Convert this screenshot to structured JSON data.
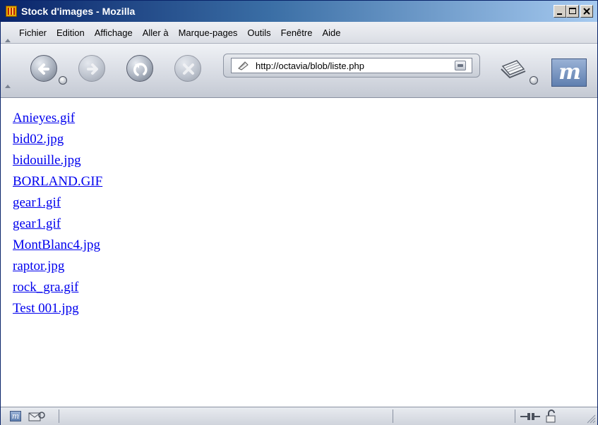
{
  "window": {
    "title": "Stock d'images - Mozilla",
    "minimize_label": "_",
    "maximize_label": "□",
    "close_label": "×"
  },
  "menubar": {
    "items": [
      "Fichier",
      "Edition",
      "Affichage",
      "Aller à",
      "Marque-pages",
      "Outils",
      "Fenêtre",
      "Aide"
    ]
  },
  "navbar": {
    "url": "http://octavia/blob/liste.php",
    "buttons": [
      {
        "name": "back",
        "icon": "back-arrow-icon",
        "enabled": true
      },
      {
        "name": "forward",
        "icon": "forward-arrow-icon",
        "enabled": false
      },
      {
        "name": "reload",
        "icon": "reload-icon",
        "enabled": true
      },
      {
        "name": "stop",
        "icon": "stop-icon",
        "enabled": false
      }
    ],
    "logo_text": "m"
  },
  "content": {
    "files": [
      "Anieyes.gif",
      "bid02.jpg",
      "bidouille.jpg",
      "BORLAND.GIF",
      "gear1.gif",
      "gear1.gif",
      "MontBlanc4.jpg",
      "raptor.jpg",
      "rock_gra.gif",
      "Test 001.jpg"
    ]
  },
  "statusbar": {
    "text": ""
  },
  "colors": {
    "link": "#0000ee",
    "titlebar_start": "#0a246a",
    "titlebar_end": "#a6caf0"
  }
}
